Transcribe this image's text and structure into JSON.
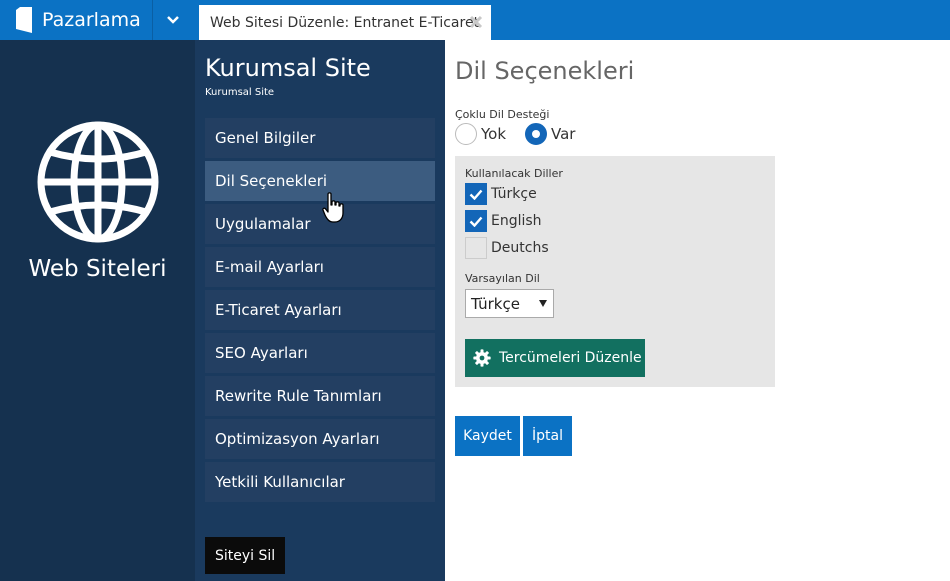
{
  "topbar": {
    "brand": "Pazarlama",
    "tab_title": "Web Sitesi Düzenle: Entranet E-Ticaret"
  },
  "rail": {
    "title": "Web Siteleri"
  },
  "site": {
    "title": "Kurumsal Site",
    "subtitle": "Kurumsal Site"
  },
  "menu": {
    "items": [
      {
        "label": "Genel Bilgiler"
      },
      {
        "label": "Dil Seçenekleri"
      },
      {
        "label": "Uygulamalar"
      },
      {
        "label": "E-mail Ayarları"
      },
      {
        "label": "E-Ticaret Ayarları"
      },
      {
        "label": "SEO Ayarları"
      },
      {
        "label": "Rewrite Rule Tanımları"
      },
      {
        "label": "Optimizasyon Ayarları"
      },
      {
        "label": "Yetkili Kullanıcılar"
      }
    ],
    "active_index": 1,
    "delete_label": "Siteyi Sil"
  },
  "content": {
    "title": "Dil Seçenekleri",
    "multi_lang_label": "Çoklu Dil Desteği",
    "radio_no": "Yok",
    "radio_yes": "Var",
    "radio_selected": "Var",
    "languages_label": "Kullanılacak Diller",
    "languages": [
      {
        "name": "Türkçe",
        "checked": true
      },
      {
        "name": "English",
        "checked": true
      },
      {
        "name": "Deutchs",
        "checked": false
      }
    ],
    "default_lang_label": "Varsayılan Dil",
    "default_lang_value": "Türkçe",
    "translate_button": "Tercümeleri Düzenle",
    "save_button": "Kaydet",
    "cancel_button": "İptal"
  },
  "colors": {
    "topbar": "#0b72c4",
    "rail": "#15314f",
    "menu_panel": "#1a3a5e",
    "menu_item": "#233f62",
    "menu_item_active": "#3c5c80",
    "accent": "#1366b8",
    "translate_button": "#127060"
  },
  "icons": {
    "brand": "bookmark-logo-icon",
    "toggle": "chevron-down-icon",
    "tab_close": "close-icon",
    "rail": "globe-icon",
    "translate": "gear-icon",
    "cursor": "hand-pointer-icon"
  }
}
